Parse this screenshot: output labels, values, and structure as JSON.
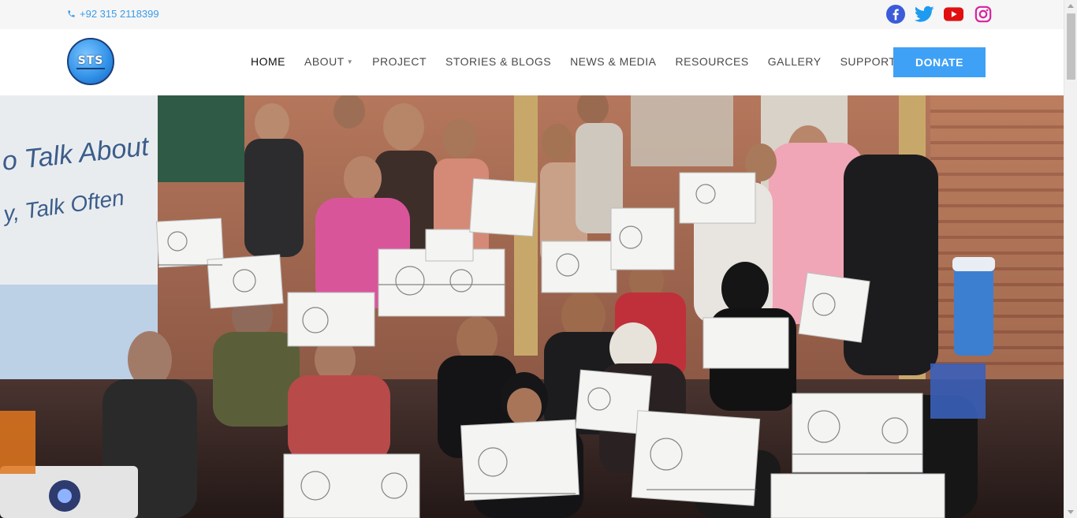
{
  "topbar": {
    "phone": "+92 315 2118399",
    "social": [
      {
        "name": "facebook",
        "icon": "facebook-icon",
        "color": "#3b5bdb"
      },
      {
        "name": "twitter",
        "icon": "twitter-icon",
        "color": "#1d9bf0"
      },
      {
        "name": "youtube",
        "icon": "youtube-icon",
        "color": "#e01010"
      },
      {
        "name": "instagram",
        "icon": "instagram-icon",
        "color": "#d6249f"
      }
    ]
  },
  "header": {
    "logo_text": "STS",
    "nav": [
      {
        "label": "HOME",
        "active": true
      },
      {
        "label": "ABOUT",
        "dropdown": true
      },
      {
        "label": "PROJECT"
      },
      {
        "label": "STORIES & BLOGS"
      },
      {
        "label": "NEWS & MEDIA"
      },
      {
        "label": "RESOURCES"
      },
      {
        "label": "GALLERY"
      },
      {
        "label": "SUPPORT US"
      }
    ],
    "donate_label": "DONATE"
  },
  "hero": {
    "banner_text_1": "o Talk About It",
    "banner_text_2": "y, Talk Often"
  },
  "colors": {
    "accent": "#3fa1f5",
    "phone_text": "#3a9be8",
    "topbar_bg": "#f6f6f6"
  }
}
